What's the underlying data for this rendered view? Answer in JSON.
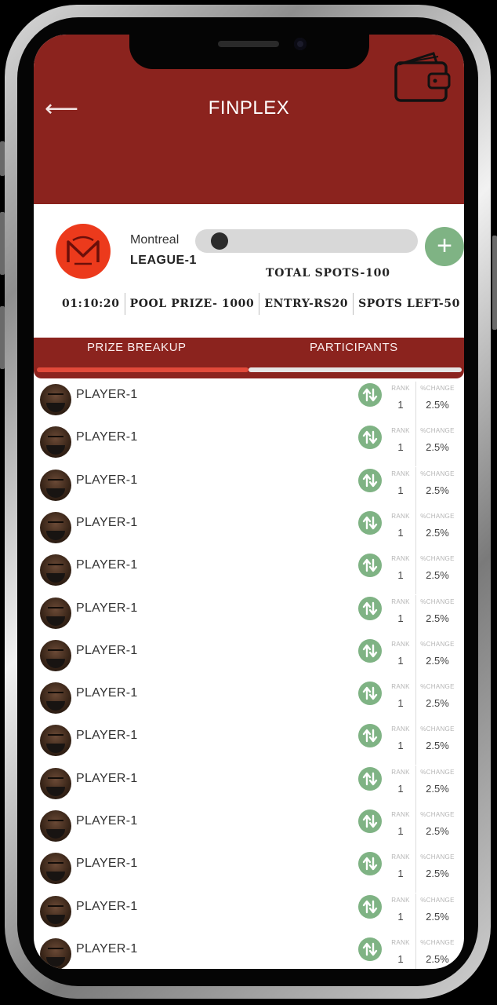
{
  "app": {
    "title": "FINPLEX"
  },
  "league": {
    "city": "Montreal",
    "name": "LEAGUE-1",
    "total_spots": "TOTAL SPOTS-100",
    "fill_fraction": 0.05
  },
  "stats": {
    "timer": "01:10:20",
    "pool_prize": "POOL PRIZE- 1000",
    "entry": "ENTRY-RS20",
    "spots_left": "SPOTS LEFT-50"
  },
  "tabs": [
    {
      "label": "PRIZE BREAKUP",
      "active": true
    },
    {
      "label": "PARTICIPANTS",
      "active": false
    }
  ],
  "list_headers": {
    "rank": "RANK",
    "change": "%CHANGE"
  },
  "players": [
    {
      "name": "PLAYER-1",
      "rank": "1",
      "change": "2.5%"
    },
    {
      "name": "PLAYER-1",
      "rank": "1",
      "change": "2.5%"
    },
    {
      "name": "PLAYER-1",
      "rank": "1",
      "change": "2.5%"
    },
    {
      "name": "PLAYER-1",
      "rank": "1",
      "change": "2.5%"
    },
    {
      "name": "PLAYER-1",
      "rank": "1",
      "change": "2.5%"
    },
    {
      "name": "PLAYER-1",
      "rank": "1",
      "change": "2.5%"
    },
    {
      "name": "PLAYER-1",
      "rank": "1",
      "change": "2.5%"
    },
    {
      "name": "PLAYER-1",
      "rank": "1",
      "change": "2.5%"
    },
    {
      "name": "PLAYER-1",
      "rank": "1",
      "change": "2.5%"
    },
    {
      "name": "PLAYER-1",
      "rank": "1",
      "change": "2.5%"
    },
    {
      "name": "PLAYER-1",
      "rank": "1",
      "change": "2.5%"
    },
    {
      "name": "PLAYER-1",
      "rank": "1",
      "change": "2.5%"
    },
    {
      "name": "PLAYER-1",
      "rank": "1",
      "change": "2.5%"
    },
    {
      "name": "PLAYER-1",
      "rank": "1",
      "change": "2.5%"
    }
  ],
  "colors": {
    "brand": "#8b231e",
    "accent_green": "#7fb384",
    "logo_red": "#ec3a1c",
    "tab_active": "#e24a3a"
  },
  "icons": {
    "back": "back-arrow-icon",
    "wallet": "wallet-icon",
    "add": "plus-icon",
    "trend": "up-down-arrows-icon"
  }
}
